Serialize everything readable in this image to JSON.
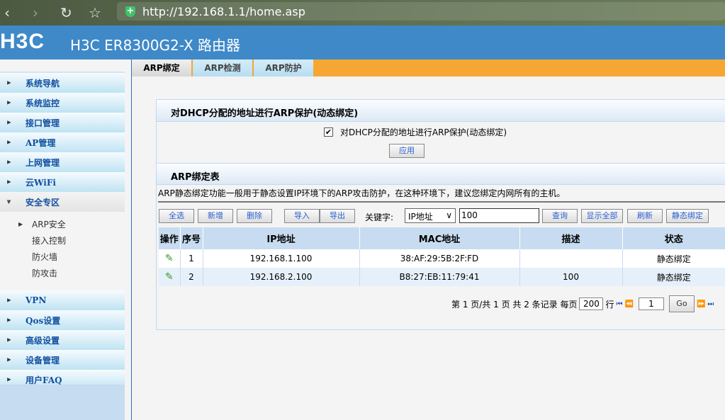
{
  "browser": {
    "url": "http://192.168.1.1/home.asp",
    "back": "‹",
    "forward": "›",
    "reload": "↻",
    "star": "☆"
  },
  "header": {
    "logo": "H3C",
    "title": "H3C ER8300G2-X 路由器"
  },
  "sidebar": {
    "items_top": [
      "系统导航",
      "系统监控",
      "接口管理",
      "AP管理",
      "上网管理",
      "云WiFi"
    ],
    "open": "安全专区",
    "sub": [
      "ARP安全",
      "接入控制",
      "防火墙",
      "防攻击"
    ],
    "items_bottom": [
      "VPN",
      "Qos设置",
      "高级设置",
      "设备管理",
      "用户FAQ"
    ]
  },
  "tabs": [
    "ARP绑定",
    "ARP检测",
    "ARP防护"
  ],
  "section1": {
    "title": "对DHCP分配的地址进行ARP保护(动态绑定)",
    "checkbox_label": "对DHCP分配的地址进行ARP保护(动态绑定)",
    "checked": true,
    "apply": "应用"
  },
  "section2": {
    "title": "ARP绑定表",
    "description": "ARP静态绑定功能一般用于静态设置IP环境下的ARP攻击防护，在这种环境下，建议您绑定内网所有的主机。"
  },
  "toolbar": {
    "select_all": "全选",
    "add": "新增",
    "delete": "删除",
    "import": "导入",
    "export": "导出",
    "keyword_label": "关键字:",
    "keyword_select": "IP地址",
    "keyword_value": "100",
    "search": "查询",
    "show_all": "显示全部",
    "refresh": "刷新",
    "static_bind": "静态绑定"
  },
  "table": {
    "headers": [
      "操作",
      "序号",
      "IP地址",
      "MAC地址",
      "描述",
      "状态"
    ],
    "rows": [
      {
        "no": "1",
        "ip": "192.168.1.100",
        "mac": "38:AF:29:5B:2F:FD",
        "desc": "",
        "status": "静态绑定"
      },
      {
        "no": "2",
        "ip": "192.168.2.100",
        "mac": "B8:27:EB:11:79:41",
        "desc": "100",
        "status": "静态绑定"
      }
    ]
  },
  "pager": {
    "summary": "第 1 页/共 1 页 共 2 条记录 每页",
    "per_page": "200",
    "row_label": "行",
    "page": "1",
    "go": "Go"
  }
}
